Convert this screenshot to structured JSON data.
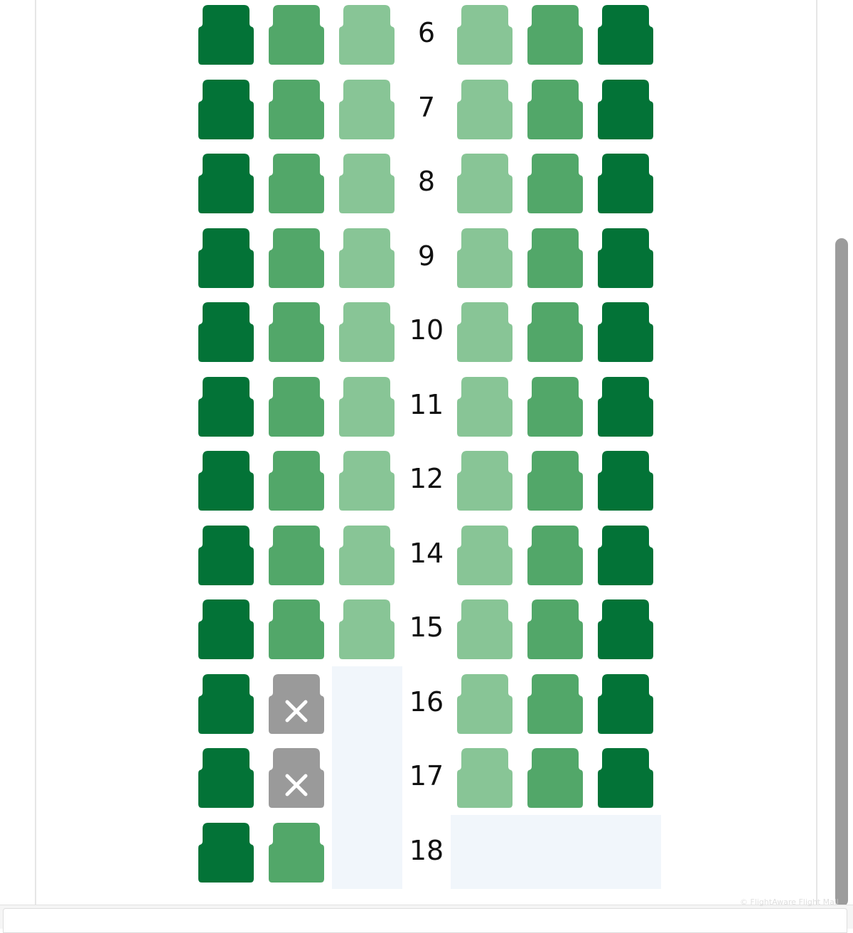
{
  "colors": {
    "window_seat": "#037337",
    "middle_seat": "#52a769",
    "aisle_seat": "#88c596",
    "unavailable_seat": "#9a9a9a",
    "no_seat_area": "#f1f6fb"
  },
  "icons": {
    "seat": "seat-icon",
    "unavailable": "close-icon"
  },
  "rows": [
    {
      "number": "6",
      "seats": [
        "window",
        "middle",
        "aisle",
        "aisle",
        "middle",
        "window"
      ]
    },
    {
      "number": "7",
      "seats": [
        "window",
        "middle",
        "aisle",
        "aisle",
        "middle",
        "window"
      ]
    },
    {
      "number": "8",
      "seats": [
        "window",
        "middle",
        "aisle",
        "aisle",
        "middle",
        "window"
      ]
    },
    {
      "number": "9",
      "seats": [
        "window",
        "middle",
        "aisle",
        "aisle",
        "middle",
        "window"
      ]
    },
    {
      "number": "10",
      "seats": [
        "window",
        "middle",
        "aisle",
        "aisle",
        "middle",
        "window"
      ]
    },
    {
      "number": "11",
      "seats": [
        "window",
        "middle",
        "aisle",
        "aisle",
        "middle",
        "window"
      ]
    },
    {
      "number": "12",
      "seats": [
        "window",
        "middle",
        "aisle",
        "aisle",
        "middle",
        "window"
      ]
    },
    {
      "number": "14",
      "seats": [
        "window",
        "middle",
        "aisle",
        "aisle",
        "middle",
        "window"
      ]
    },
    {
      "number": "15",
      "seats": [
        "window",
        "middle",
        "aisle",
        "aisle",
        "middle",
        "window"
      ]
    },
    {
      "number": "16",
      "seats": [
        "window",
        "unavailable",
        "none",
        "aisle",
        "middle",
        "window"
      ]
    },
    {
      "number": "17",
      "seats": [
        "window",
        "unavailable",
        "none",
        "aisle",
        "middle",
        "window"
      ]
    },
    {
      "number": "18",
      "seats": [
        "window",
        "middle",
        "none",
        "none",
        "none",
        "none"
      ]
    }
  ],
  "watermark": "© FlightAware Flight Mall"
}
